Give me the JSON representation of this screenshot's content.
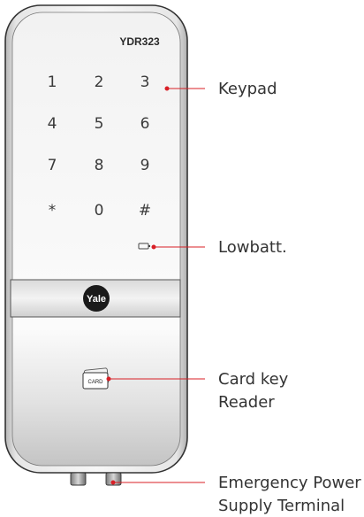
{
  "device": {
    "model": "YDR323",
    "brand_badge": "Yale",
    "card_label": "CARD",
    "keypad_keys": [
      "1",
      "2",
      "3",
      "4",
      "5",
      "6",
      "7",
      "8",
      "9",
      "*",
      "0",
      "#"
    ]
  },
  "callouts": {
    "keypad": "Keypad",
    "lowbatt": "Lowbatt.",
    "card_reader_line1": "Card key",
    "card_reader_line2": "Reader",
    "emergency_line1": "Emergency Power",
    "emergency_line2": "Supply Terminal"
  },
  "colors": {
    "leader_line": "#d81f26",
    "body_outline": "#333333",
    "badge": "#1a1a1a"
  }
}
